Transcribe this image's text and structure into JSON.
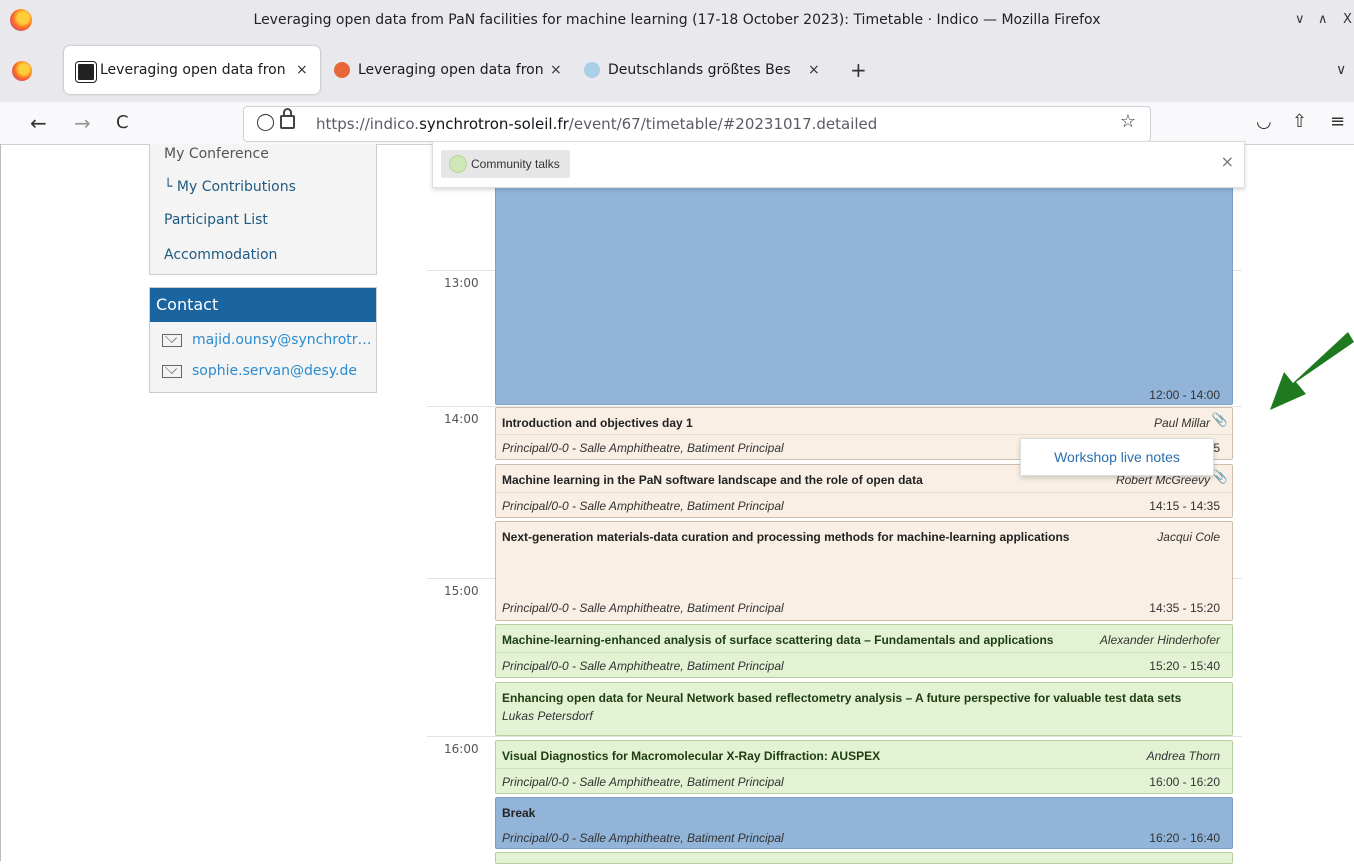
{
  "window": {
    "title": "Leveraging open data from PaN facilities for machine learning (17-18 October 2023): Timetable · Indico — Mozilla Firefox",
    "controls": [
      "∨",
      "∧",
      "X"
    ]
  },
  "tabs": [
    {
      "label": "Leveraging open data fron",
      "close": "×",
      "active": true
    },
    {
      "label": "Leveraging open data fron",
      "close": "×",
      "active": false
    },
    {
      "label": "Deutschlands größtes Bes",
      "close": "×",
      "active": false
    }
  ],
  "new_tab": "+",
  "tab_list": "∨",
  "nav": {
    "back": "←",
    "forward": "→",
    "reload": "C",
    "url_prefix": "https://indico.",
    "url_domain": "synchrotron-soleil.fr",
    "url_path": "/event/67/timetable/#20231017.detailed"
  },
  "sidebar": {
    "menu": [
      {
        "label": "My Conference"
      },
      {
        "label": "└  My Contributions"
      },
      {
        "label": "Participant List"
      },
      {
        "label": "Accommodation"
      }
    ],
    "contact": {
      "heading": "Contact",
      "emails": [
        "majid.ounsy@synchrotr…",
        "sophie.servan@desy.de"
      ]
    }
  },
  "popup": {
    "chip_label": "Community talks",
    "close": "×"
  },
  "tooltip": {
    "label": "Workshop live notes"
  },
  "hours": [
    "13:00",
    "14:00",
    "15:00",
    "16:00"
  ],
  "timetable": {
    "session_block": {
      "time": "12:00 - 14:00"
    },
    "entries": [
      {
        "title": "Introduction and objectives day 1",
        "speaker": "Paul Millar",
        "location": "Principal/0-0 - Salle Amphitheatre, Batiment Principal",
        "time": "5"
      },
      {
        "title": "Machine learning in the PaN software landscape and the role of open data",
        "speaker": "Robert McGreevy",
        "location": "Principal/0-0 - Salle Amphitheatre, Batiment Principal",
        "time": "14:15 - 14:35"
      },
      {
        "title": "Next-generation materials-data curation and processing methods for machine-learning applications",
        "speaker": "Jacqui Cole",
        "location": "Principal/0-0 - Salle Amphitheatre, Batiment Principal",
        "time": "14:35 - 15:20"
      },
      {
        "title": "Machine-learning-enhanced analysis of surface scattering data – Fundamentals and applications",
        "speaker": "Alexander Hinderhofer",
        "location": "Principal/0-0 - Salle Amphitheatre, Batiment Principal",
        "time": "15:20 - 15:40"
      },
      {
        "title": "Enhancing open data for Neural Network based reflectometry analysis – A future perspective for valuable test data sets",
        "speaker": "Lukas Petersdorf"
      },
      {
        "title": "Visual Diagnostics for Macromolecular X-Ray Diffraction: AUSPEX",
        "speaker": "Andrea Thorn",
        "location": "Principal/0-0 - Salle Amphitheatre, Batiment Principal",
        "time": "16:00 - 16:20"
      },
      {
        "title": "Break",
        "location": "Principal/0-0 - Salle Amphitheatre, Batiment Principal",
        "time": "16:20 - 16:40"
      }
    ]
  },
  "colors": {
    "session_blue": "#92b4d9",
    "talk_orange": "#f9efe4",
    "talk_green": "#e3f2d3",
    "contact_header": "#1a64a0",
    "arrow_green": "#1f7a1f"
  }
}
